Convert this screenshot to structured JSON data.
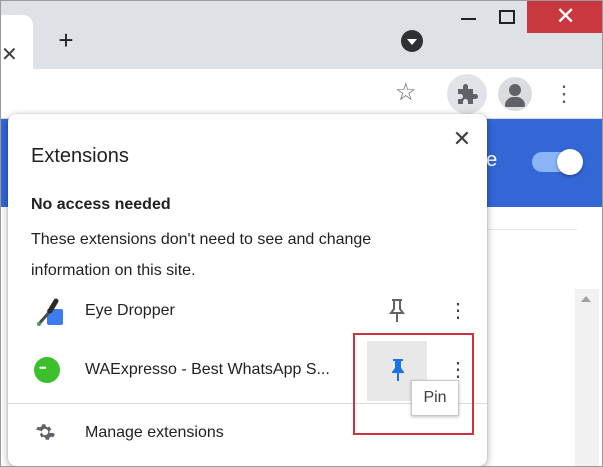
{
  "window": {
    "tab_close_glyph": "✕",
    "new_tab_glyph": "+",
    "close_glyph": "✕"
  },
  "toolbar": {
    "star_glyph": "☆",
    "menu_glyph": "⋮"
  },
  "page": {
    "banner_text_fragment": "de",
    "banner_color": "#3367d6"
  },
  "popup": {
    "title": "Extensions",
    "close_glyph": "✕",
    "section_heading": "No access needed",
    "section_description": "These extensions don't need to see and change information on this site.",
    "extensions": [
      {
        "name": "Eye Dropper",
        "icon": "eye-dropper-icon",
        "pinned": false
      },
      {
        "name": "WAExpresso - Best WhatsApp S...",
        "icon": "waexpresso-icon",
        "pinned": true
      }
    ],
    "more_glyph": "⋮",
    "manage_label": "Manage extensions"
  },
  "tooltip": {
    "text": "Pin"
  },
  "colors": {
    "accent": "#1a73e8",
    "highlight_border": "#d0313a",
    "window_close": "#c9373f"
  }
}
